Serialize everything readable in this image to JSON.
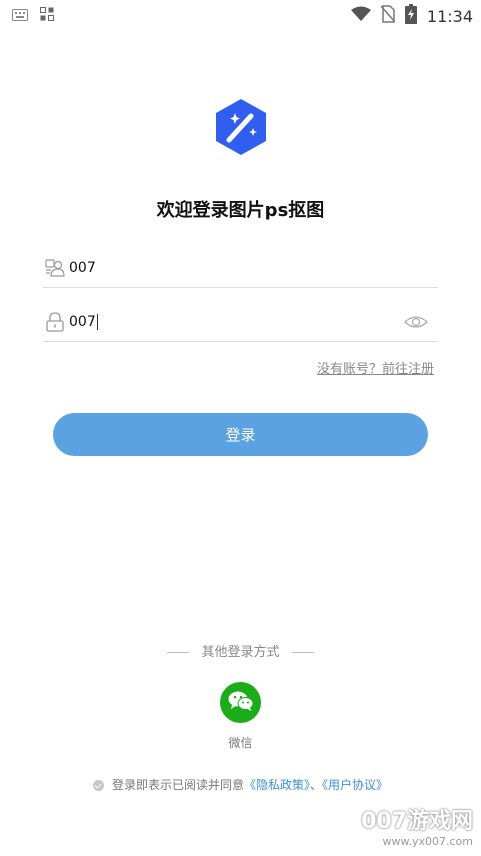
{
  "status_bar": {
    "time": "11:34",
    "left_icons": [
      "keyboard-icon",
      "grid-apps-icon"
    ],
    "right_icons": [
      "wifi-icon",
      "no-sim-icon",
      "battery-charging-icon"
    ]
  },
  "app": {
    "title": "欢迎登录图片ps抠图",
    "logo_color": "#2f5ef0"
  },
  "form": {
    "username_value": "007",
    "password_value": "007",
    "register_link": "没有账号？前往注册",
    "login_button": "登录"
  },
  "other_login": {
    "title": "其他登录方式",
    "wechat_label": "微信"
  },
  "agreement": {
    "prefix": "登录即表示已阅读并同意",
    "privacy": "《隐私政策》",
    "separator": "、",
    "terms": "《用户协议》"
  },
  "watermark": {
    "brand": "007游戏网",
    "url": "www.yx007.com"
  },
  "colors": {
    "accent": "#5ba2e3",
    "wechat": "#1aad19",
    "link": "#3f8fd8"
  }
}
